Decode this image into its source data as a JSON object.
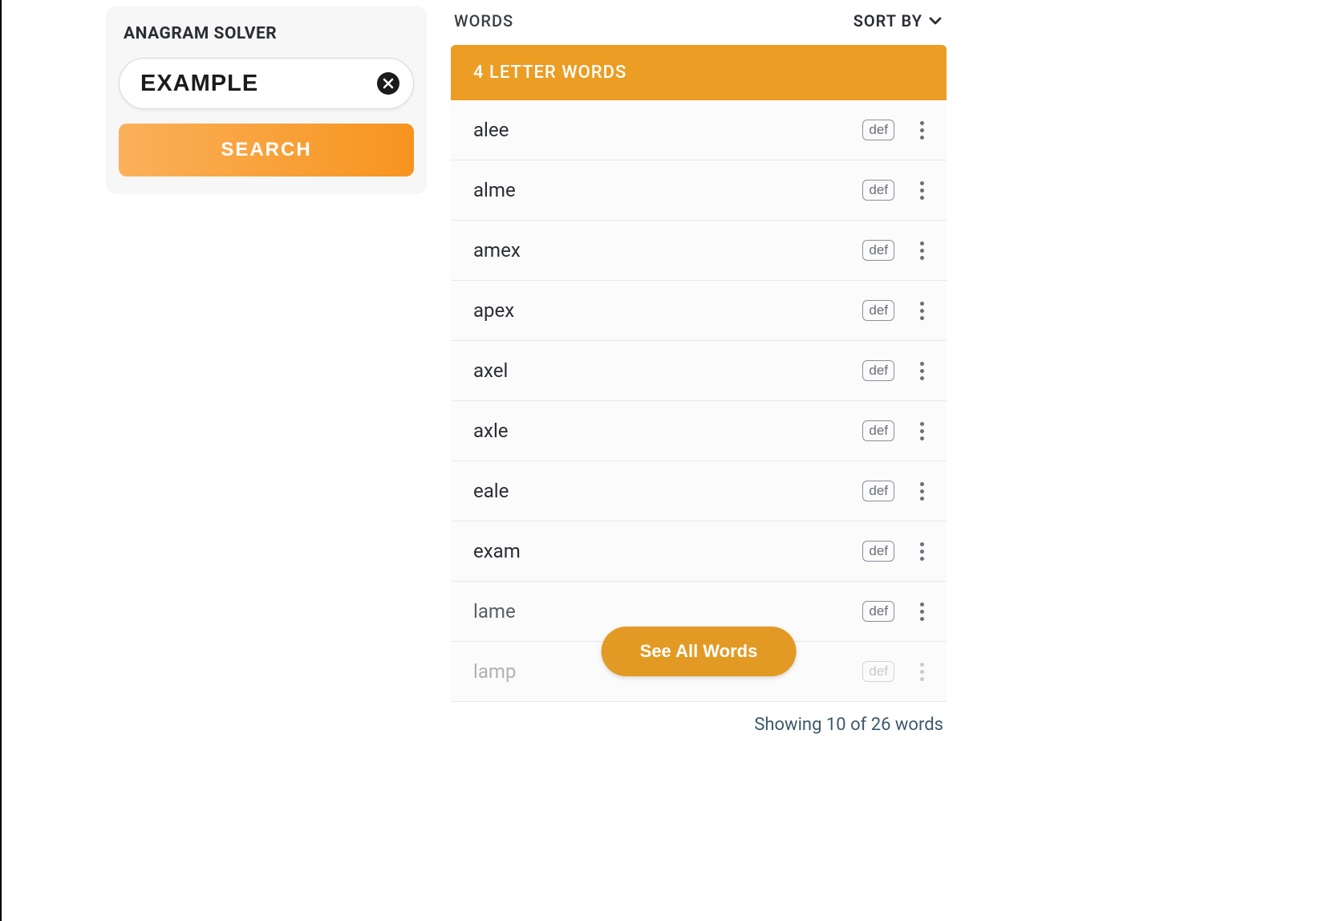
{
  "solver": {
    "title": "ANAGRAM SOLVER",
    "input_value": "EXAMPLE",
    "search_label": "SEARCH"
  },
  "results": {
    "words_label": "WORDS",
    "sort_label": "SORT BY",
    "section_header": "4 LETTER WORDS",
    "def_label": "def",
    "words": [
      "alee",
      "alme",
      "amex",
      "apex",
      "axel",
      "axle",
      "eale",
      "exam",
      "lame",
      "lamp"
    ],
    "see_all_label": "See All Words",
    "summary": "Showing 10 of 26 words"
  }
}
